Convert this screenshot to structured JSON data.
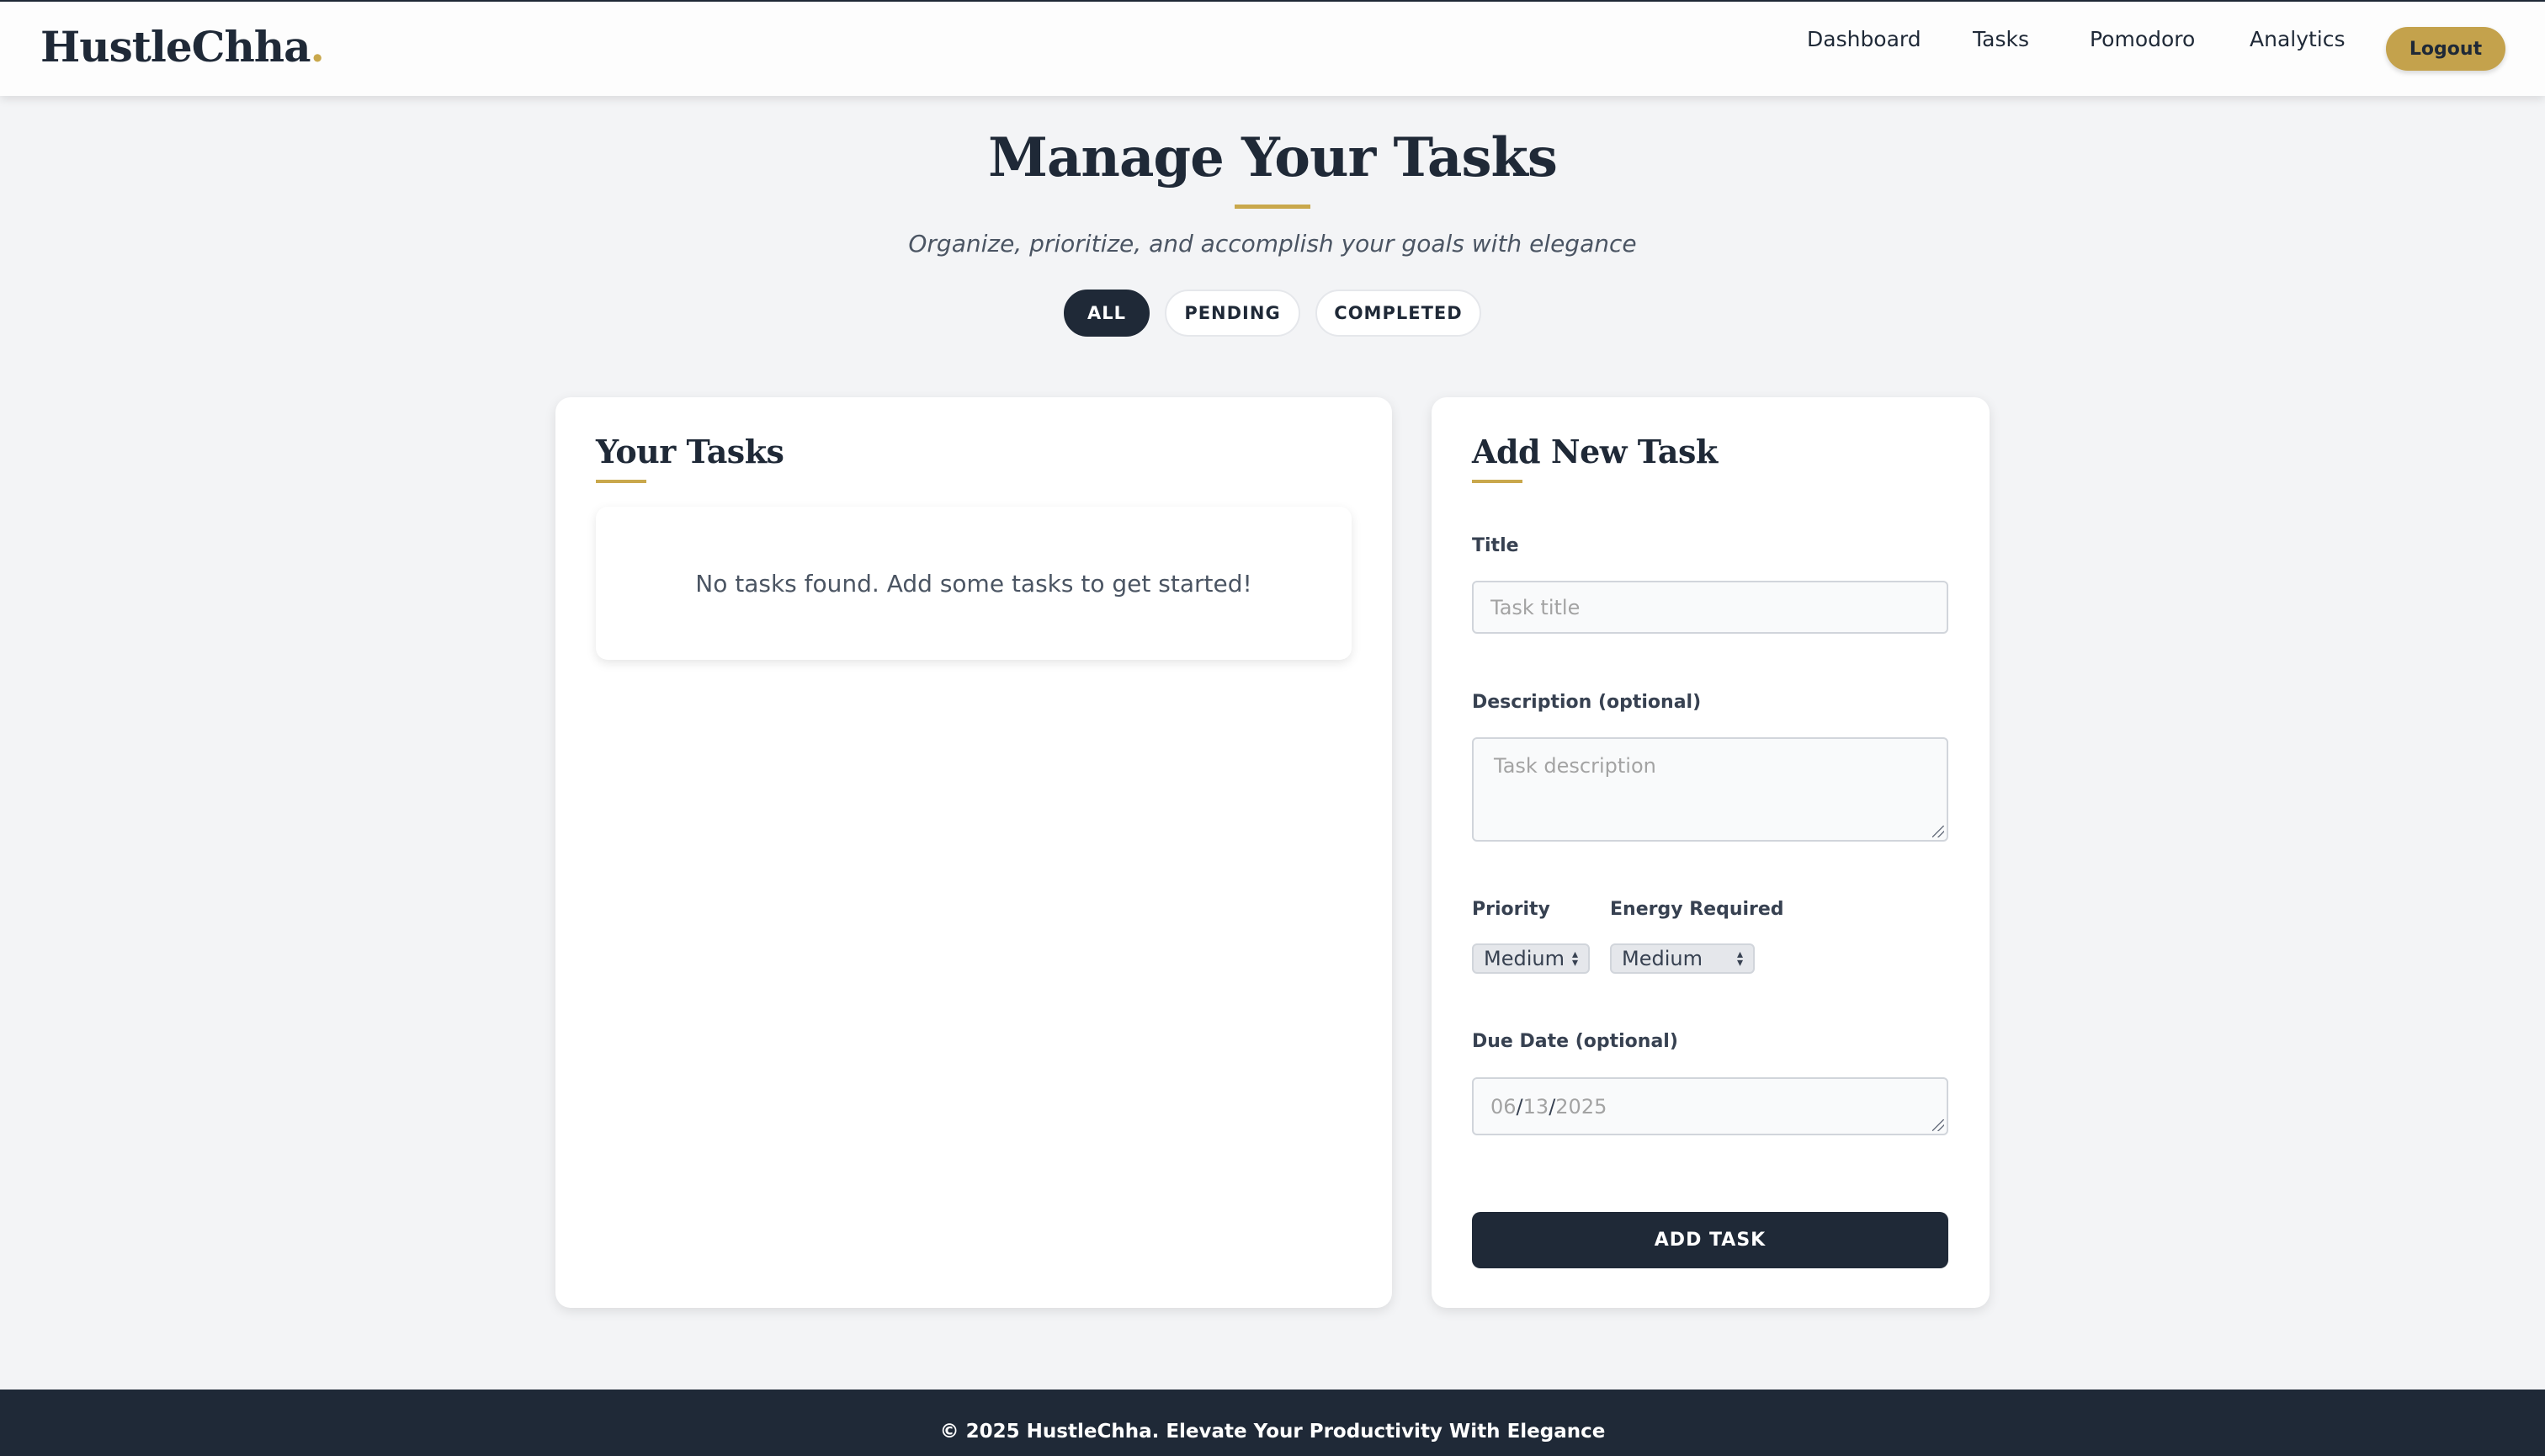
{
  "brand": {
    "name": "HustleChha",
    "dot": "."
  },
  "nav": {
    "items": [
      "Dashboard",
      "Tasks",
      "Pomodoro",
      "Analytics"
    ],
    "logout_label": "Logout"
  },
  "header": {
    "title": "Manage Your Tasks",
    "subtitle": "Organize, prioritize, and accomplish your goals with elegance"
  },
  "filters": [
    {
      "label": "ALL",
      "active": true
    },
    {
      "label": "PENDING",
      "active": false
    },
    {
      "label": "COMPLETED",
      "active": false
    }
  ],
  "tasks_panel": {
    "title": "Your Tasks",
    "empty_message": "No tasks found. Add some tasks to get started!"
  },
  "form": {
    "title": "Add New Task",
    "title_label": "Title",
    "title_placeholder": "Task title",
    "description_label": "Description (optional)",
    "description_placeholder": "Task description",
    "priority_label": "Priority",
    "priority_value": "Medium",
    "energy_label": "Energy Required",
    "energy_value": "Medium",
    "due_date_label": "Due Date (optional)",
    "due_date": {
      "month": "06",
      "day": "13",
      "year": "2025",
      "separator": "/"
    },
    "submit_label": "ADD TASK"
  },
  "footer": {
    "text": "© 2025 HustleChha. Elevate Your Productivity With Elegance"
  },
  "colors": {
    "accent": "#c9a84c",
    "dark": "#1f2937",
    "background": "#f3f4f6"
  }
}
